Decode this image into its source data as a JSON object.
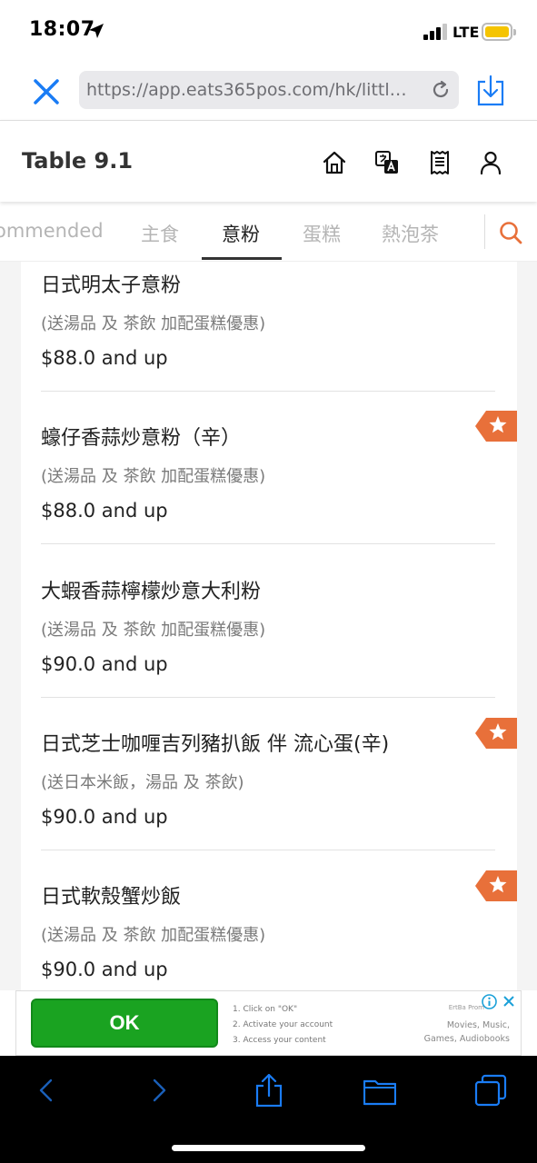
{
  "status_bar": {
    "time": "18:07",
    "network": "LTE"
  },
  "browser": {
    "url": "https://app.eats365pos.com/hk/littlei..."
  },
  "header": {
    "table_title": "Table 9.1",
    "icons": [
      "home-icon",
      "translate-icon",
      "receipt-icon",
      "user-icon"
    ]
  },
  "tabs": [
    {
      "label": "ommended"
    },
    {
      "label": "主食"
    },
    {
      "label": "意粉"
    },
    {
      "label": "蛋糕"
    },
    {
      "label": "熱泡茶"
    }
  ],
  "active_tab": "意粉",
  "menu_items": [
    {
      "name": "日式明太子意粉",
      "desc": "(送湯品 及 茶飲 加配蛋糕優惠)",
      "price": "$88.0 and up",
      "starred": false
    },
    {
      "name": "蠔仔香蒜炒意粉（辛）",
      "desc": "(送湯品 及 茶飲 加配蛋糕優惠)",
      "price": "$88.0 and up",
      "starred": true
    },
    {
      "name": "大蝦香蒜檸檬炒意大利粉",
      "desc": "(送湯品 及 茶飲 加配蛋糕優惠)",
      "price": "$90.0 and up",
      "starred": false
    },
    {
      "name": "日式芝士咖喱吉列豬扒飯 伴 流心蛋(辛)",
      "desc": "(送日本米飯，湯品 及 茶飲)",
      "price": "$90.0 and up",
      "starred": true
    },
    {
      "name": "日式軟殼蟹炒飯",
      "desc": "(送湯品 及 茶飲 加配蛋糕優惠)",
      "price": "$90.0 and up",
      "starred": true
    }
  ],
  "ad": {
    "button_label": "OK",
    "steps": [
      "1. Click on \"OK\"",
      "2. Activate your account",
      "3. Access your content"
    ],
    "right_line1": "Movies, Music,",
    "right_line2": "Games, Audiobooks",
    "brand": "ErtBa Prom"
  },
  "colors": {
    "accent_orange": "#e8703a",
    "ios_blue": "#1a7cf5",
    "ad_green": "#1aa321",
    "battery_yellow": "#f5c400"
  }
}
